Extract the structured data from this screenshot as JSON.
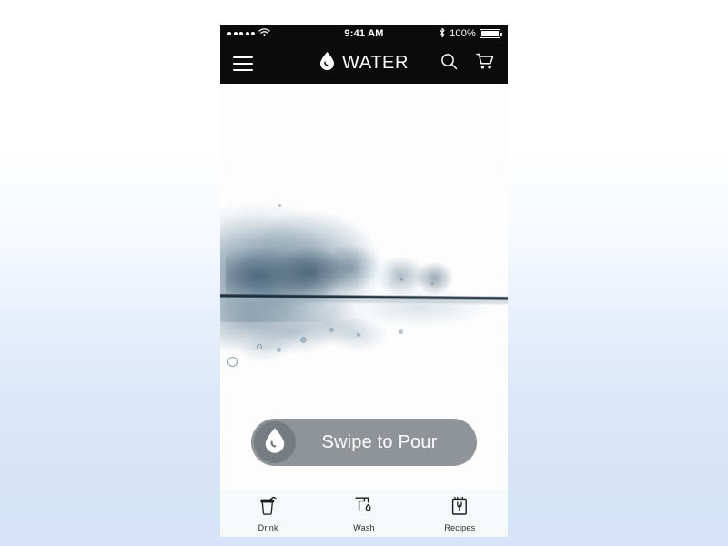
{
  "theme": {
    "page_bg_top": "#ffffff",
    "page_bg_bottom": "#d6e3f8",
    "appbar_bg": "#0b0b0b",
    "accent_white": "#ffffff",
    "swipe_track": "#8e9498",
    "swipe_knob": "#757c82",
    "tabbar_bg": "#f7f8fa",
    "tab_label": "#2b2b2b"
  },
  "statusbar": {
    "signal_dots": 5,
    "wifi_icon": "wifi-icon",
    "time": "9:41 AM",
    "bluetooth_icon": "bluetooth-icon",
    "battery_percent": "100%",
    "battery_icon": "battery-full-icon"
  },
  "appbar": {
    "menu_icon": "hamburger-menu-icon",
    "logo_icon": "water-drop-icon",
    "title": "WATER",
    "search_icon": "search-icon",
    "cart_icon": "shopping-cart-icon"
  },
  "hero": {
    "photo_alt": "water-splash-photo",
    "swipe": {
      "knob_icon": "water-drop-icon",
      "label": "Swipe to Pour"
    }
  },
  "tabbar": {
    "tabs": [
      {
        "label": "Drink",
        "icon": "cup-with-straw-icon"
      },
      {
        "label": "Wash",
        "icon": "faucet-drop-icon"
      },
      {
        "label": "Recipes",
        "icon": "notepad-fork-icon"
      }
    ]
  }
}
